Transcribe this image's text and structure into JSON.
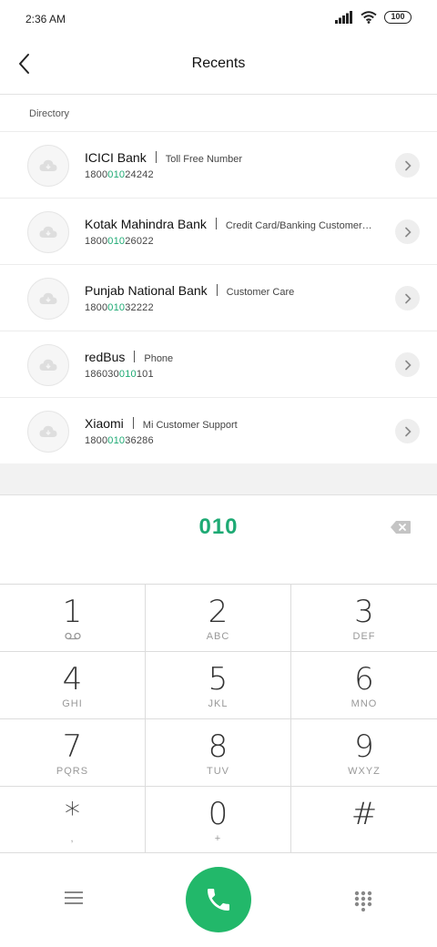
{
  "status_bar": {
    "time": "2:36 AM",
    "battery": "100"
  },
  "header": {
    "title": "Recents"
  },
  "directory": {
    "label": "Directory",
    "items": [
      {
        "name": "ICICI Bank",
        "desc": "Toll Free Number",
        "num_pre": "1800",
        "num_hl": "010",
        "num_post": "24242"
      },
      {
        "name": "Kotak Mahindra Bank",
        "desc": "Credit Card/Banking Customer…",
        "num_pre": "1800",
        "num_hl": "010",
        "num_post": "26022"
      },
      {
        "name": "Punjab National Bank",
        "desc": "Customer Care",
        "num_pre": "1800",
        "num_hl": "010",
        "num_post": "32222"
      },
      {
        "name": "redBus",
        "desc": "Phone",
        "num_pre": "186030",
        "num_hl": "010",
        "num_post": "101"
      },
      {
        "name": "Xiaomi",
        "desc": "Mi Customer Support",
        "num_pre": "1800",
        "num_hl": "010",
        "num_post": "36286"
      }
    ]
  },
  "dialer": {
    "entered_number": "010",
    "keys": [
      {
        "digit": "1",
        "letters": ""
      },
      {
        "digit": "2",
        "letters": "ABC"
      },
      {
        "digit": "3",
        "letters": "DEF"
      },
      {
        "digit": "4",
        "letters": "GHI"
      },
      {
        "digit": "5",
        "letters": "JKL"
      },
      {
        "digit": "6",
        "letters": "MNO"
      },
      {
        "digit": "7",
        "letters": "PQRS"
      },
      {
        "digit": "8",
        "letters": "TUV"
      },
      {
        "digit": "9",
        "letters": "WXYZ"
      },
      {
        "digit": "*",
        "letters": ","
      },
      {
        "digit": "0",
        "letters": "+"
      },
      {
        "digit": "#",
        "letters": ""
      }
    ]
  },
  "icons": {
    "back": "back-arrow-icon",
    "avatar": "cloud-icon",
    "chevron": "chevron-right-icon",
    "backspace": "backspace-icon",
    "voicemail": "voicemail-icon",
    "menu": "menu-icon",
    "call": "phone-icon",
    "keypad": "keypad-icon"
  },
  "colors": {
    "accent": "#1eaa74",
    "call_button": "#22b86a"
  }
}
